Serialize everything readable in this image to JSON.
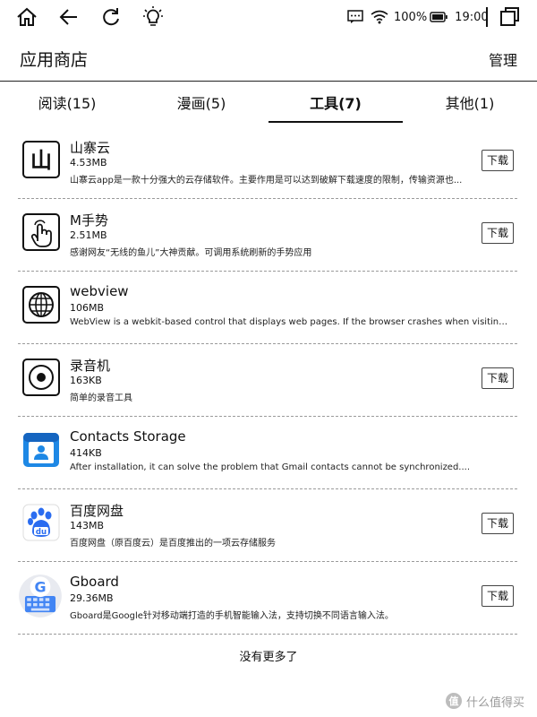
{
  "status_bar": {
    "battery": "100%",
    "time": "19:00",
    "icons": [
      "home-icon",
      "back-arrow-icon",
      "refresh-icon",
      "lightbulb-icon",
      "message-icon",
      "wifi-icon",
      "battery-icon",
      "window-icon"
    ]
  },
  "header": {
    "title": "应用商店",
    "manage": "管理"
  },
  "tabs": [
    {
      "label": "阅读(15)"
    },
    {
      "label": "漫画(5)"
    },
    {
      "label": "工具(7)",
      "active": true
    },
    {
      "label": "其他(1)"
    }
  ],
  "apps": [
    {
      "name": "山寨云",
      "size": "4.53MB",
      "desc": "山寨云app是一款十分强大的云存储软件。主要作用是可以达到破解下载速度的限制，传输资源也...",
      "button": "下载",
      "icon": "shanzhaiyun-logo-icon",
      "icon_text": "山"
    },
    {
      "name": "M手势",
      "size": "2.51MB",
      "desc": "感谢网友“无线的鱼儿”大神贡献。可调用系统刷新的手势应用",
      "button": "下载",
      "icon": "hand-gesture-icon"
    },
    {
      "name": "webview",
      "size": "106MB",
      "desc": "WebView is a webkit-based control that displays web pages. If the browser crashes when visiting other web...",
      "button": "",
      "icon": "globe-icon"
    },
    {
      "name": "录音机",
      "size": "163KB",
      "desc": "简单的录音工具",
      "button": "下载",
      "icon": "record-icon"
    },
    {
      "name": "Contacts Storage",
      "size": "414KB",
      "desc": "After installation, it can solve the problem that Gmail contacts cannot be synchronized....",
      "button": "",
      "icon": "contacts-icon"
    },
    {
      "name": "百度网盘",
      "size": "143MB",
      "desc": "百度网盘（原百度云）是百度推出的一项云存储服务",
      "button": "下载",
      "icon": "baidu-netdisk-icon",
      "icon_text": "du"
    },
    {
      "name": "Gboard",
      "size": "29.36MB",
      "desc": "Gboard是Google针对移动端打造的手机智能输入法，支持切换不同语言输入法。",
      "button": "下载",
      "icon": "gboard-icon",
      "icon_text": "G"
    }
  ],
  "footer": "没有更多了",
  "watermark": "什么值得买",
  "colors": {
    "contacts_blue": "#1e88e5",
    "baidu_blue": "#2a6cf0",
    "gboard_blue": "#4285f4"
  }
}
